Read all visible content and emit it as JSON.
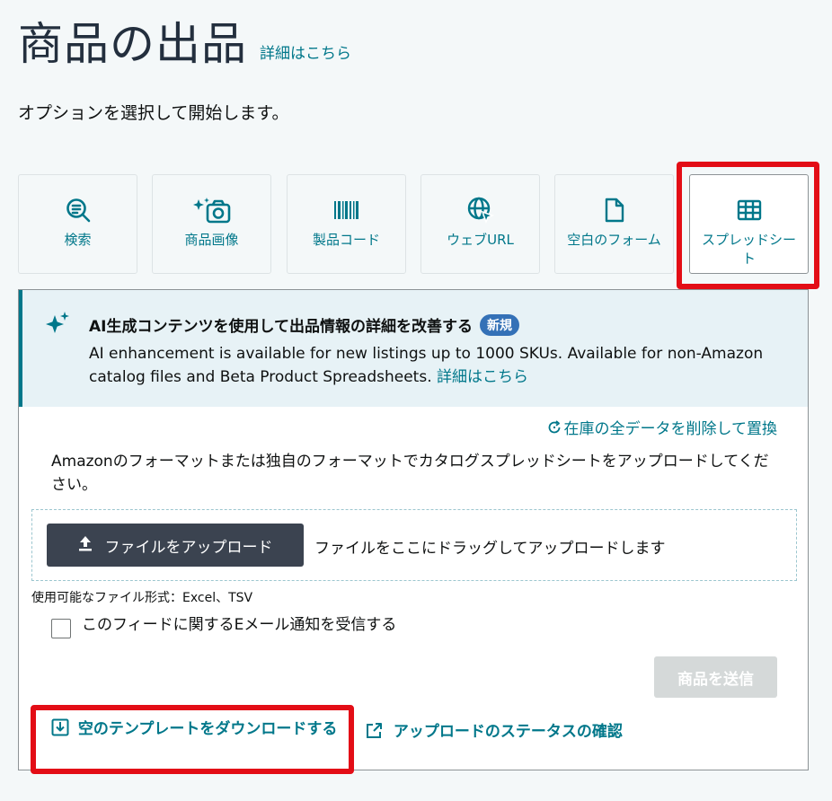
{
  "header": {
    "title": "商品の出品",
    "title_link": "詳細はこちら",
    "subtitle": "オプションを選択して開始します。"
  },
  "options": [
    {
      "label": "検索",
      "icon": "search-list-icon"
    },
    {
      "label": "商品画像",
      "icon": "camera-sparkle-icon"
    },
    {
      "label": "製品コード",
      "icon": "barcode-icon"
    },
    {
      "label": "ウェブURL",
      "icon": "globe-cursor-icon"
    },
    {
      "label": "空白のフォーム",
      "icon": "blank-document-icon"
    },
    {
      "label": "スプレッドシート",
      "icon": "spreadsheet-icon",
      "selected": true
    }
  ],
  "ai_banner": {
    "heading": "AI生成コンテンツを使用して出品情報の詳細を改善する",
    "badge": "新規",
    "body": "AI enhancement is available for new listings up to 1000 SKUs. Available for non-Amazon catalog files and Beta Product Spreadsheets.",
    "link": "詳細はこちら"
  },
  "upload": {
    "replace_link": "在庫の全データを削除して置換",
    "instructions": "Amazonのフォーマットまたは独自のフォーマットでカタログスプレッドシートをアップロードしてください。",
    "button_label": "ファイルをアップロード",
    "drop_hint": "ファイルをここにドラッグしてアップロードします",
    "formats": "使用可能なファイル形式：Excel、TSV",
    "email_checkbox_label": "このフィードに関するEメール通知を受信する",
    "email_checked": false,
    "submit_label": "商品を送信"
  },
  "footer": {
    "download_template": "空のテンプレートをダウンロードする",
    "check_status": "アップロードのステータスの確認"
  },
  "colors": {
    "accent": "#00778a",
    "highlight": "#e30d16",
    "button_dark": "#3b4350",
    "badge": "#3471b7"
  }
}
